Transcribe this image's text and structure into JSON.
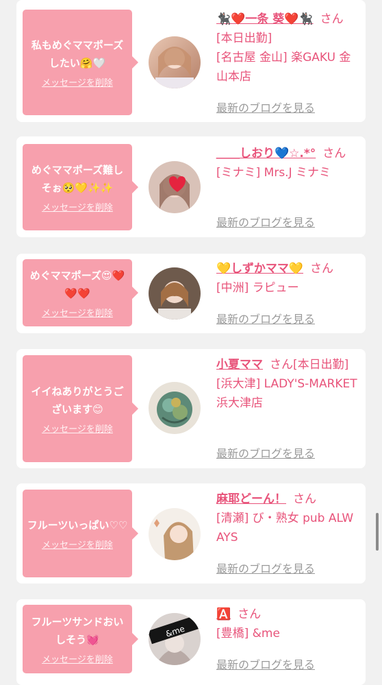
{
  "colors": {
    "background": "#f1f1f1",
    "card": "#ffffff",
    "bubble": "#f7a0ad",
    "accent": "#e8537a",
    "blog_link": "#9a9a9a"
  },
  "cards": [
    {
      "message": "私もめぐママポーズしたい🤗🤍",
      "delete_label": "メッセージを削除",
      "avatar_icon": "user-photo-icon",
      "name": "🐈‍⬛❤️一条 葵❤️🐈‍⬛",
      "san": "さん",
      "status": "[本日出勤]",
      "shop": "[名古屋 金山] 楽GAKU 金山本店",
      "blog_label": "最新のブログを見る"
    },
    {
      "message": "めぐママポーズ難しそぉ🥺💛✨✨",
      "delete_label": "メッセージを削除",
      "avatar_icon": "user-photo-icon",
      "name": "＿＿しおり💙☆.*°",
      "san": "さん",
      "status": "",
      "shop": "[ミナミ] Mrs.J ミナミ",
      "blog_label": "最新のブログを見る"
    },
    {
      "message": "めぐママポーズ😍❤️❤️❤️",
      "delete_label": "メッセージを削除",
      "avatar_icon": "user-photo-icon",
      "name": "💛しずかママ💛",
      "san": "さん",
      "status": "",
      "shop": "[中洲] ラピュー",
      "blog_label": "最新のブログを見る"
    },
    {
      "message": "イイねありがとうございます😊",
      "delete_label": "メッセージを削除",
      "avatar_icon": "user-photo-icon",
      "name": "小夏ママ",
      "san": "さん",
      "status": "[本日出勤]",
      "shop": "[浜大津] LADY'S-MARKET 浜大津店",
      "blog_label": "最新のブログを見る"
    },
    {
      "message": "フルーツいっぱい♡♡",
      "delete_label": "メッセージを削除",
      "avatar_icon": "user-photo-icon",
      "name": "麻耶どーん！",
      "san": "さん",
      "status": "",
      "shop": "[清瀬] び・熟女 pub ALWAYS",
      "blog_label": "最新のブログを見る"
    },
    {
      "message": "フルーツサンドおいしそう💓",
      "delete_label": "メッセージを削除",
      "avatar_icon": "user-photo-icon",
      "avatar_text": "&me",
      "name": "🅰️",
      "san": "さん",
      "status": "",
      "shop": "[豊橋] &me",
      "blog_label": "最新のブログを見る"
    }
  ]
}
